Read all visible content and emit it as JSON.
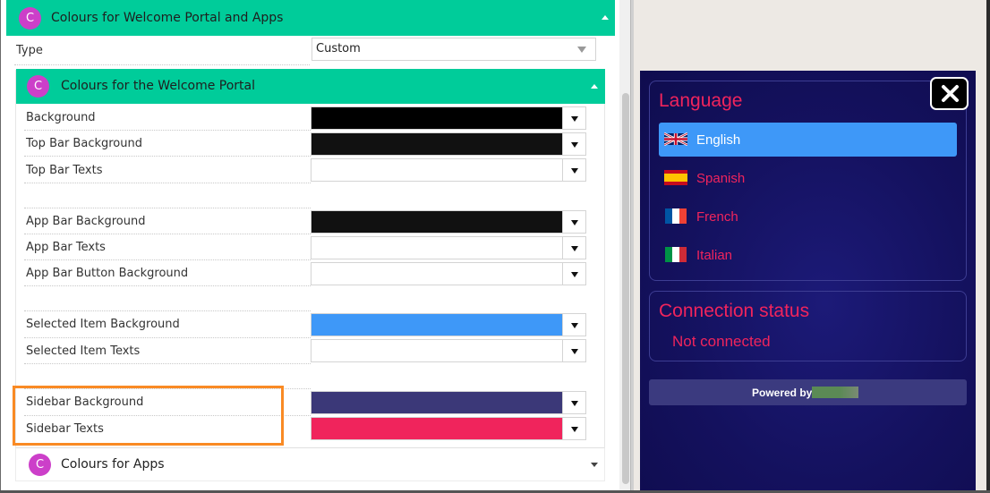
{
  "colors": {
    "accent_green": "#00cc9a",
    "badge_magenta": "#cc3fc9",
    "highlight_orange": "#f98a24",
    "sidebar_bg": "#14115e",
    "sidebar_text": "#f0245c",
    "selected_item_bg": "#3e98f8"
  },
  "settings": {
    "main_section": {
      "badge": "C",
      "title": "Colours for Welcome Portal and Apps",
      "expanded": true
    },
    "type": {
      "label": "Type",
      "value": "Custom"
    },
    "portal_section": {
      "badge": "C",
      "title": "Colours for the Welcome Portal",
      "expanded": true,
      "rows": [
        {
          "label": "Background",
          "color": "#000000"
        },
        {
          "label": "Top Bar Background",
          "color": "#111111"
        },
        {
          "label": "Top Bar Texts",
          "color": "#ffffff"
        },
        {
          "label": "App Bar Background",
          "color": "#111111"
        },
        {
          "label": "App Bar Texts",
          "color": "#ffffff"
        },
        {
          "label": "App Bar Button Background",
          "color": "#ffffff"
        },
        {
          "label": "Selected Item Background",
          "color": "#3e98f8"
        },
        {
          "label": "Selected Item Texts",
          "color": "#ffffff"
        },
        {
          "label": "Sidebar Background",
          "color": "#3b3878"
        },
        {
          "label": "Sidebar Texts",
          "color": "#f0245c"
        }
      ]
    },
    "apps_section": {
      "badge": "C",
      "title": "Colours for Apps",
      "expanded": false
    }
  },
  "preview": {
    "language_title": "Language",
    "languages": [
      {
        "label": "English",
        "flag": "uk-flag-icon",
        "selected": true
      },
      {
        "label": "Spanish",
        "flag": "spain-flag-icon",
        "selected": false
      },
      {
        "label": "French",
        "flag": "france-flag-icon",
        "selected": false
      },
      {
        "label": "Italian",
        "flag": "italy-flag-icon",
        "selected": false
      }
    ],
    "connection_title": "Connection status",
    "connection_value": "Not connected",
    "powered_by": "Powered by",
    "close_icon": "close-icon"
  }
}
